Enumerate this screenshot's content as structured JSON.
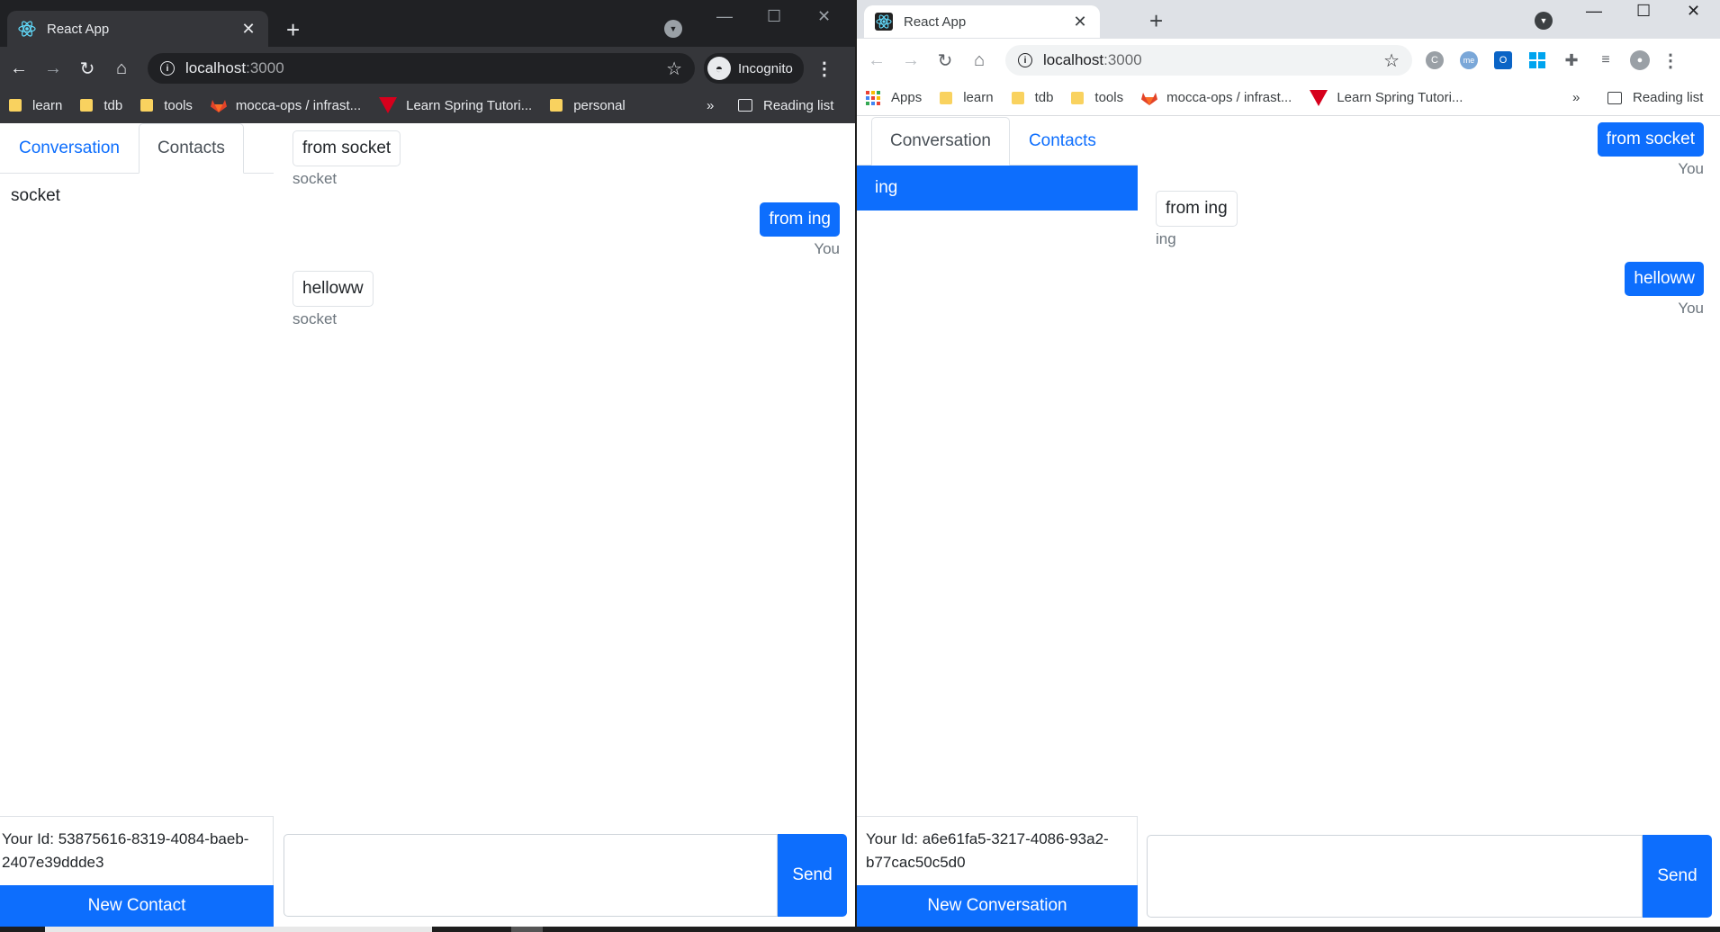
{
  "left_window": {
    "tab_title": "React App",
    "url_host": "localhost",
    "url_port": ":3000",
    "incognito_label": "Incognito",
    "bookmarks": [
      "learn",
      "tdb",
      "tools",
      "mocca-ops / infrast...",
      "Learn Spring Tutori...",
      "personal"
    ],
    "overflow_label": "»",
    "reading_list_label": "Reading list",
    "app": {
      "tabs": [
        "Conversation",
        "Contacts"
      ],
      "active_tab": "Contacts",
      "contacts": [
        "socket"
      ],
      "your_id_label": "Your Id: 53875616-8319-4084-baeb-2407e39ddde3",
      "action_button": "New Contact",
      "messages": [
        {
          "text": "from socket",
          "sender": "socket",
          "direction": "in"
        },
        {
          "text": "from ing",
          "sender": "You",
          "direction": "out"
        },
        {
          "text": "helloww",
          "sender": "socket",
          "direction": "in"
        }
      ],
      "input_value": "",
      "send_label": "Send"
    }
  },
  "right_window": {
    "tab_title": "React App",
    "url_host": "localhost",
    "url_port": ":3000",
    "apps_label": "Apps",
    "bookmarks": [
      "learn",
      "tdb",
      "tools",
      "mocca-ops / infrast...",
      "Learn Spring Tutori..."
    ],
    "overflow_label": "»",
    "reading_list_label": "Reading list",
    "app": {
      "tabs": [
        "Conversation",
        "Contacts"
      ],
      "active_tab": "Conversation",
      "conversations": [
        "ing"
      ],
      "your_id_label": "Your Id: a6e61fa5-3217-4086-93a2-b77cac50c5d0",
      "action_button": "New Conversation",
      "messages": [
        {
          "text": "from socket",
          "sender": "You",
          "direction": "out"
        },
        {
          "text": "from ing",
          "sender": "ing",
          "direction": "in"
        },
        {
          "text": "helloww",
          "sender": "You",
          "direction": "out"
        }
      ],
      "input_value": "",
      "send_label": "Send"
    }
  },
  "colors": {
    "primary": "#0d6efd",
    "dark_chrome": "#35363a",
    "light_chrome": "#dee1e6"
  }
}
